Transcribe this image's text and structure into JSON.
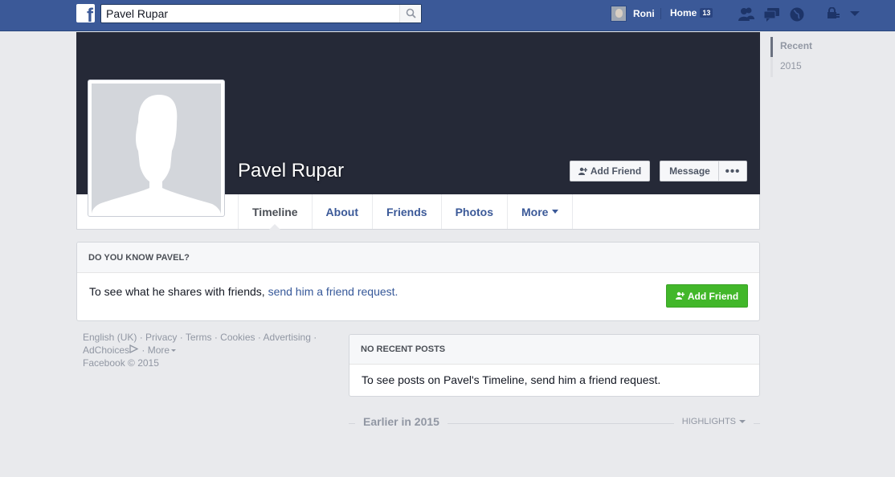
{
  "topbar": {
    "logo": "f",
    "search_value": "Pavel Rupar",
    "search_icon": "search-icon",
    "user_name": "Roni",
    "home_label": "Home",
    "home_count": "13"
  },
  "scrubber": {
    "items": [
      {
        "label": "Recent"
      },
      {
        "label": "2015"
      }
    ]
  },
  "profile": {
    "name": "Pavel Rupar",
    "add_friend": "Add Friend",
    "message": "Message",
    "more": "•••"
  },
  "tabs": [
    {
      "label": "Timeline"
    },
    {
      "label": "About"
    },
    {
      "label": "Friends"
    },
    {
      "label": "Photos"
    },
    {
      "label": "More"
    }
  ],
  "know_box": {
    "header": "DO YOU KNOW PAVEL?",
    "text_before": "To see what he shares with friends, ",
    "link": "send him a friend request.",
    "button": "Add Friend"
  },
  "footer": {
    "english": "English (UK)",
    "privacy": "Privacy",
    "terms": "Terms",
    "cookies": "Cookies",
    "advertising": "Advertising",
    "adchoices": "AdChoices",
    "more": "More",
    "copyright": "Facebook © 2015"
  },
  "posts_box": {
    "header": "NO RECENT POSTS",
    "text": "To see posts on Pavel's Timeline, send him a friend request."
  },
  "earlier": {
    "label": "Earlier in 2015",
    "highlights": "HIGHLIGHTS"
  },
  "colors": {
    "brand_blue": "#3b5998",
    "cover_dark": "#252937",
    "green": "#42b72a"
  }
}
